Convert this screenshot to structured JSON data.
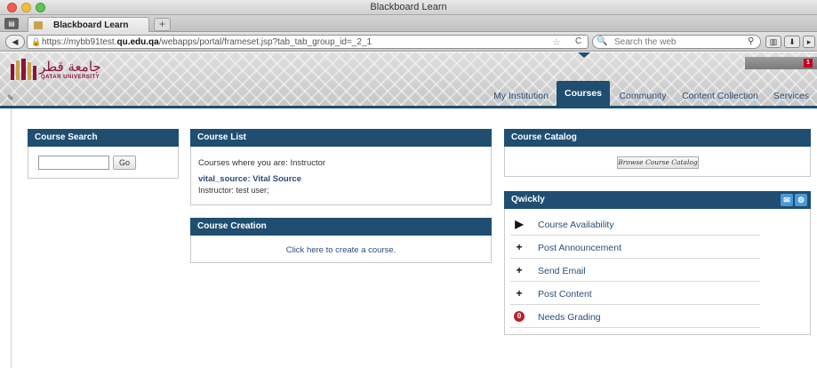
{
  "window": {
    "title": "Blackboard Learn"
  },
  "browser": {
    "tab_label": "Blackboard Learn",
    "new_tab": "+",
    "url_prefix": "https://mybb91test.",
    "url_domain": "qu.edu.qa",
    "url_path": "/webapps/portal/frameset.jsp?tab_tab_group_id=_2_1",
    "search_placeholder": "Search the web",
    "icons": [
      "back-icon",
      "lock-icon",
      "star-icon",
      "reload-icon",
      "search-engine-icon",
      "magnifier-icon",
      "bookmarks-icon",
      "downloads-icon"
    ]
  },
  "header": {
    "logo_arabic": "جامعة قطر",
    "logo_english": "QATAR UNIVERSITY",
    "account_name": "",
    "notice_count": "1",
    "tabs": [
      {
        "label": "My Institution",
        "active": false
      },
      {
        "label": "Courses",
        "active": true
      },
      {
        "label": "Community",
        "active": false
      },
      {
        "label": "Content Collection",
        "active": false
      },
      {
        "label": "Services",
        "active": false
      }
    ],
    "active_tab_color": "#1f4e71"
  },
  "modules": {
    "course_search": {
      "title": "Course Search",
      "input_value": "",
      "go_label": "Go"
    },
    "course_list": {
      "title": "Course List",
      "role_text": "Courses where you are: Instructor",
      "course_link": "vital_source: Vital Source",
      "instructor_text": "Instructor: test user;"
    },
    "course_creation": {
      "title": "Course Creation",
      "link": "Click here to create a course."
    },
    "course_catalog": {
      "title": "Course Catalog",
      "button_label": "Browse Course Catalog"
    },
    "qwickly": {
      "title": "Qwickly",
      "items": [
        {
          "label": "Course Availability",
          "icon": "triangle-right-icon"
        },
        {
          "label": "Post Announcement",
          "icon": "plus-icon"
        },
        {
          "label": "Send Email",
          "icon": "plus-icon"
        },
        {
          "label": "Post Content",
          "icon": "plus-icon"
        },
        {
          "label": "Needs Grading",
          "icon": "count-badge-icon",
          "count": "0"
        }
      ]
    }
  }
}
